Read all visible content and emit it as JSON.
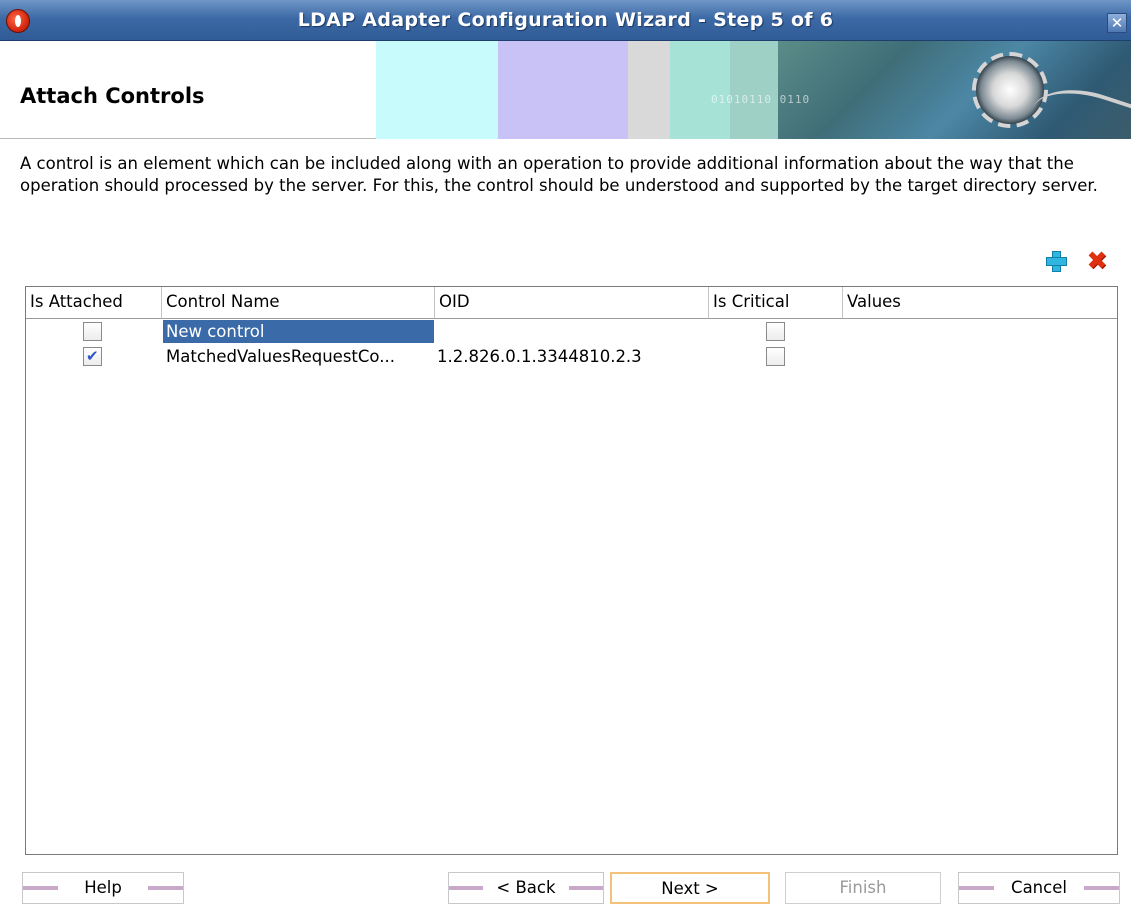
{
  "window": {
    "title": "LDAP Adapter Configuration Wizard - Step 5 of 6",
    "close_label": "✕"
  },
  "header": {
    "title": "Attach Controls",
    "banner_text": "01010110 0110"
  },
  "description": "A control is an element which can be included along with an operation to provide additional information about the way that the operation should processed by the server. For this, the control should be understood and supported by the target directory server.",
  "toolbar": {
    "add_icon": "add-icon",
    "delete_icon": "delete-icon",
    "delete_label": "✖"
  },
  "table": {
    "columns": [
      "Is Attached",
      "Control Name",
      "OID",
      "Is Critical",
      "Values"
    ],
    "rows": [
      {
        "is_attached": false,
        "control_name": "New control",
        "oid": "",
        "is_critical": false,
        "values": "",
        "selected": true
      },
      {
        "is_attached": true,
        "control_name": "MatchedValuesRequestCo...",
        "oid": "1.2.826.0.1.3344810.2.3",
        "is_critical": false,
        "values": "",
        "selected": false
      }
    ],
    "check_glyph": "✔"
  },
  "buttons": {
    "help": "Help",
    "back": "< Back",
    "next": "Next >",
    "finish": "Finish",
    "cancel": "Cancel"
  },
  "colors": {
    "titlebar": "#3d6aa6",
    "selection": "#3b6aa8",
    "add_icon": "#2fb5e0",
    "delete_icon": "#e03010",
    "primary_button_border": "#f2c27a"
  }
}
